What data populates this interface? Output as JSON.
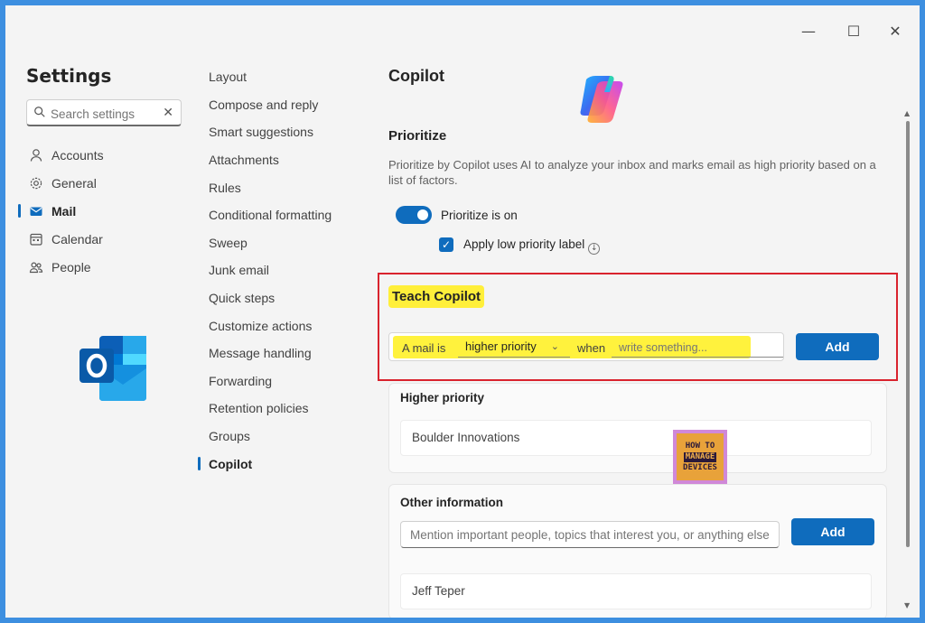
{
  "window": {
    "controls": {
      "minimize": "—",
      "maximize": "☐",
      "close": "✕"
    }
  },
  "sidebar": {
    "title": "Settings",
    "search": {
      "placeholder": "Search settings",
      "clear_icon": "✕"
    },
    "items": [
      {
        "label": "Accounts",
        "icon": "person-icon",
        "active": false
      },
      {
        "label": "General",
        "icon": "gear-icon",
        "active": false
      },
      {
        "label": "Mail",
        "icon": "mail-icon",
        "active": true
      },
      {
        "label": "Calendar",
        "icon": "calendar-icon",
        "active": false
      },
      {
        "label": "People",
        "icon": "people-icon",
        "active": false
      }
    ]
  },
  "mail_nav": {
    "items": [
      "Layout",
      "Compose and reply",
      "Smart suggestions",
      "Attachments",
      "Rules",
      "Conditional formatting",
      "Sweep",
      "Junk email",
      "Quick steps",
      "Customize actions",
      "Message handling",
      "Forwarding",
      "Retention policies",
      "Groups",
      "Copilot"
    ],
    "active": "Copilot"
  },
  "content": {
    "title": "Copilot",
    "prioritize": {
      "heading": "Prioritize",
      "description": "Prioritize by Copilot uses AI to analyze your inbox and marks email as high priority based on a list of factors.",
      "toggle_label": "Prioritize is on",
      "toggle_on": true,
      "checkbox_label": "Apply low priority label",
      "checkbox_checked": true
    },
    "teach": {
      "heading": "Teach Copilot",
      "prefix": "A mail is",
      "priority_selected": "higher priority",
      "when_label": "when",
      "input_placeholder": "write something...",
      "add_label": "Add"
    },
    "higher_priority": {
      "heading": "Higher priority",
      "entries": [
        "Boulder Innovations"
      ]
    },
    "other_information": {
      "heading": "Other information",
      "input_placeholder": "Mention important people, topics that interest you, or anything else",
      "add_label": "Add",
      "entries": [
        "Jeff Teper"
      ]
    }
  },
  "watermark": {
    "line1": "HOW TO",
    "line2": "MANAGE",
    "line3": "DEVICES"
  },
  "colors": {
    "accent": "#0f6cbd",
    "highlight": "#ffef3a",
    "frame_red": "#d9232d",
    "border_blue": "#3d8fe0"
  }
}
